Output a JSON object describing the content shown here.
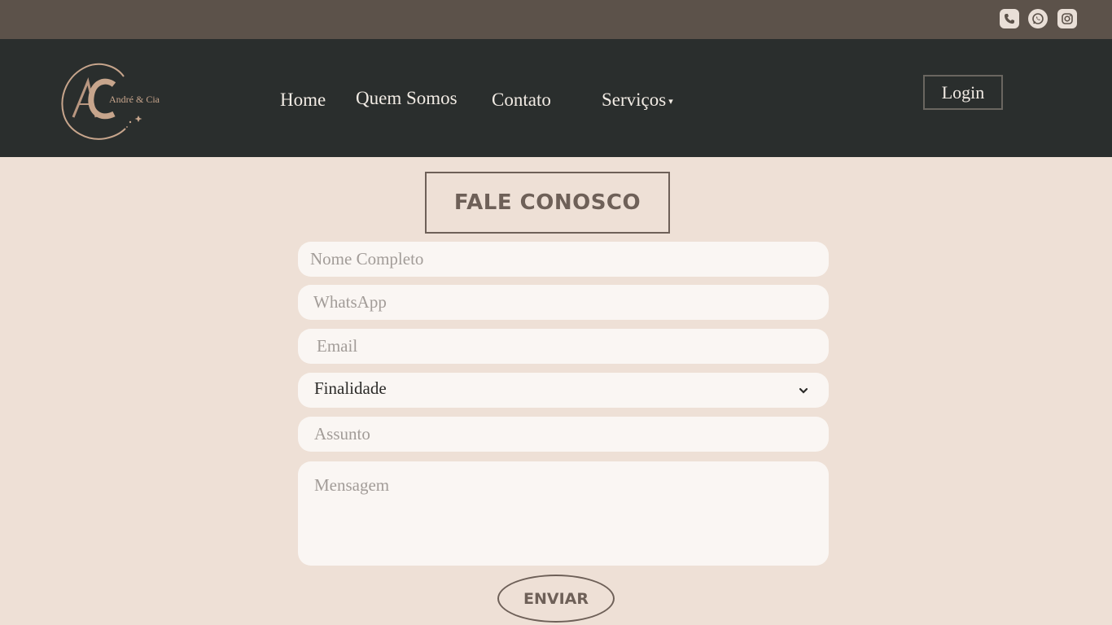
{
  "topbar": {
    "icons": [
      "phone-icon",
      "whatsapp-icon",
      "instagram-icon"
    ],
    "bg_color": "#5c524a"
  },
  "navbar": {
    "bg_color": "#2a2e2d",
    "logo_text": "André & Cia",
    "logo_initials": "AC",
    "items": [
      {
        "label": "Home"
      },
      {
        "label": "Quem Somos"
      },
      {
        "label": "Contato"
      },
      {
        "label": "Serviços"
      }
    ],
    "services_caret": "▾",
    "login_label": "Login"
  },
  "form": {
    "title": "FALE CONOSCO",
    "nome_placeholder": "Nome Completo",
    "whatsapp_placeholder": "WhatsApp",
    "email_placeholder": "Email",
    "finalidade_value": "Finalidade",
    "assunto_placeholder": "Assunto",
    "mensagem_placeholder": "Mensagem",
    "submit_label": "ENVIAR"
  },
  "colors": {
    "page_bg": "#eee0d6",
    "accent": "#6e6058",
    "logo_gold": "#c7a58c"
  }
}
